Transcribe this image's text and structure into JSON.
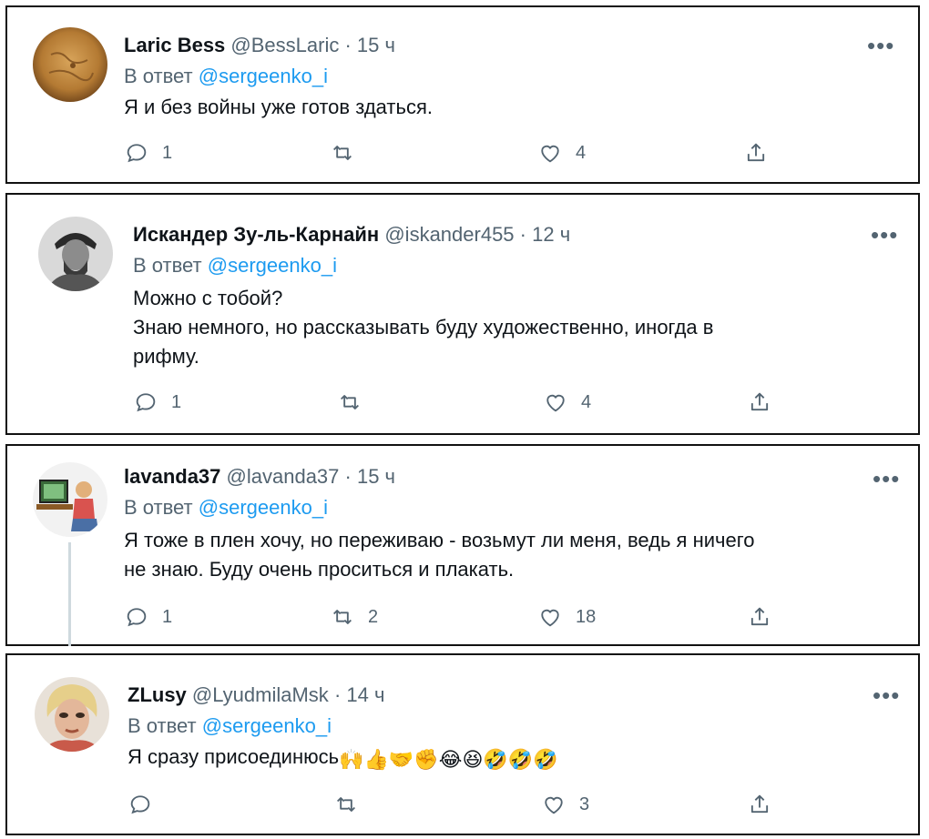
{
  "tweets": [
    {
      "name": "Laric Bess",
      "handle": "@BessLaric",
      "time": "· 15 ч",
      "reply_prefix": "В ответ",
      "reply_to": "@sergeenko_i",
      "lines": [
        "Я и без войны уже готов здаться."
      ],
      "replies": "1",
      "retweets": "",
      "likes": "4"
    },
    {
      "name": "Искандер Зу-ль-Карнайн",
      "handle": "@iskander455",
      "time": "· 12 ч",
      "reply_prefix": "В ответ",
      "reply_to": "@sergeenko_i",
      "lines": [
        "Можно с тобой?",
        "Знаю немного, но рассказывать буду художественно, иногда в",
        "рифму."
      ],
      "replies": "1",
      "retweets": "",
      "likes": "4"
    },
    {
      "name": "lavanda37",
      "handle": "@lavanda37",
      "time": "· 15 ч",
      "reply_prefix": "В ответ",
      "reply_to": "@sergeenko_i",
      "lines": [
        "Я тоже в плен хочу, но переживаю - возьмут ли  меня, ведь я ничего",
        "не знаю. Буду очень проситься и плакать."
      ],
      "replies": "1",
      "retweets": "2",
      "likes": "18"
    },
    {
      "name": "ZLusy",
      "handle": "@LyudmilaMsk",
      "time": "· 14 ч",
      "reply_prefix": "В ответ",
      "reply_to": "@sergeenko_i",
      "lines": [
        "Я сразу присоединюсь"
      ],
      "emojis": [
        "🙌",
        "👍",
        "🤝",
        "✊",
        "😂",
        "😆",
        "🤣",
        "🤣",
        "🤣"
      ],
      "replies": "",
      "retweets": "",
      "likes": "3"
    }
  ],
  "more_label": "•••",
  "colors": {
    "link": "#1d9bf0",
    "muted": "#536471",
    "text": "#0f1419",
    "border": "#111111"
  },
  "icons": {
    "reply": "reply-icon",
    "retweet": "retweet-icon",
    "like": "heart-icon",
    "share": "share-icon",
    "more": "more-icon"
  }
}
